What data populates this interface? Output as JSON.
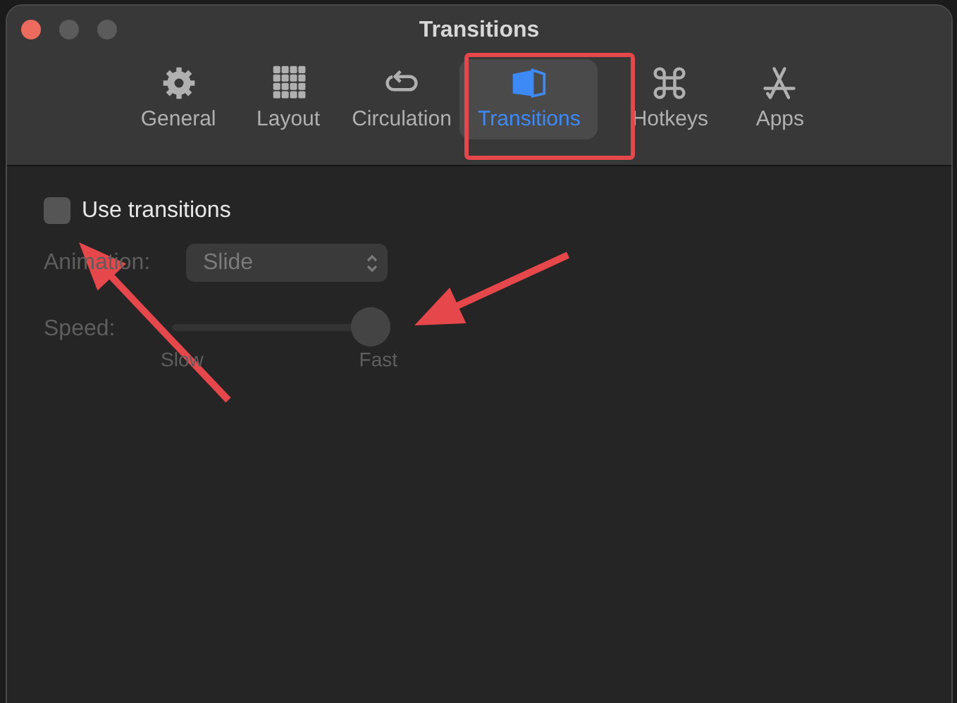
{
  "window": {
    "title": "Transitions"
  },
  "tabs": [
    {
      "label": "General",
      "selected": false
    },
    {
      "label": "Layout",
      "selected": false
    },
    {
      "label": "Circulation",
      "selected": false
    },
    {
      "label": "Transitions",
      "selected": true
    },
    {
      "label": "Hotkeys",
      "selected": false
    },
    {
      "label": "Apps",
      "selected": false
    }
  ],
  "use_transitions": {
    "label": "Use transitions",
    "checked": false
  },
  "animation": {
    "label": "Animation:",
    "value": "Slide",
    "disabled": true
  },
  "speed": {
    "label": "Speed:",
    "level": 1,
    "min_label": "Slow",
    "max_label": "Fast",
    "disabled": true
  },
  "annotations": [
    {
      "kind": "box"
    },
    {
      "kind": "arrow"
    },
    {
      "kind": "arrow"
    }
  ]
}
